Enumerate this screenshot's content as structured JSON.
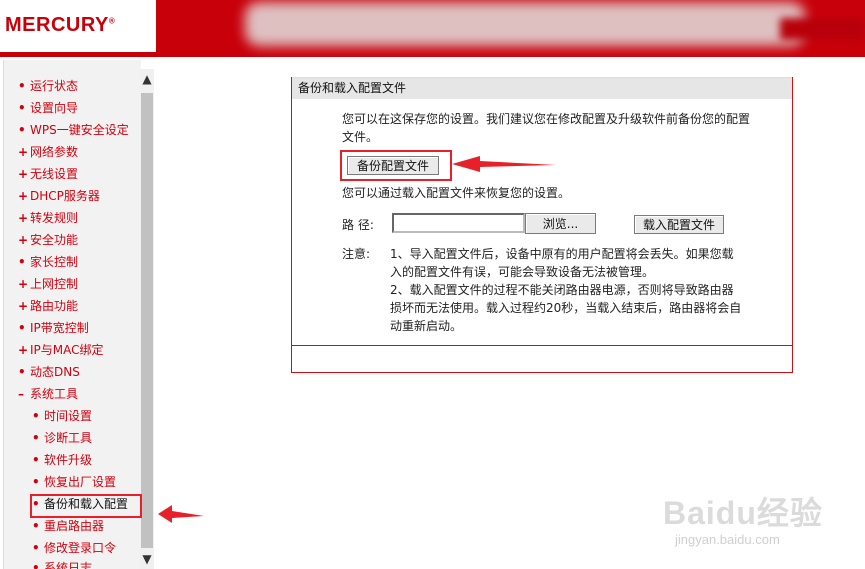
{
  "header": {
    "brand": "MERCURY",
    "brand_mark": "®"
  },
  "sidebar": {
    "items": [
      {
        "label": "运行状态",
        "bullet": "•"
      },
      {
        "label": "设置向导",
        "bullet": "•"
      },
      {
        "label": "WPS一键安全设定",
        "bullet": "•"
      },
      {
        "label": "网络参数",
        "bullet": "+"
      },
      {
        "label": "无线设置",
        "bullet": "+"
      },
      {
        "label": "DHCP服务器",
        "bullet": "+"
      },
      {
        "label": "转发规则",
        "bullet": "+"
      },
      {
        "label": "安全功能",
        "bullet": "+"
      },
      {
        "label": "家长控制",
        "bullet": "•"
      },
      {
        "label": "上网控制",
        "bullet": "+"
      },
      {
        "label": "路由功能",
        "bullet": "+"
      },
      {
        "label": "IP带宽控制",
        "bullet": "•"
      },
      {
        "label": "IP与MAC绑定",
        "bullet": "+"
      },
      {
        "label": "动态DNS",
        "bullet": "•"
      },
      {
        "label": "系统工具",
        "bullet": "–"
      }
    ],
    "sub_items": [
      {
        "label": "时间设置",
        "bullet": "•"
      },
      {
        "label": "诊断工具",
        "bullet": "•"
      },
      {
        "label": "软件升级",
        "bullet": "•"
      },
      {
        "label": "恢复出厂设置",
        "bullet": "•"
      },
      {
        "label": "备份和载入配置",
        "bullet": "•"
      },
      {
        "label": "重启路由器",
        "bullet": "•"
      },
      {
        "label": "修改登录口令",
        "bullet": "•"
      },
      {
        "label": "系统日志",
        "bullet": "•"
      }
    ],
    "scroll_up_icon": "▲",
    "scroll_down_icon": "▼"
  },
  "panel": {
    "title": "备份和载入配置文件",
    "intro": "您可以在这保存您的设置。我们建议您在修改配置及升级软件前备份您的配置文件。",
    "backup_button": "备份配置文件",
    "restore_text": "您可以通过载入配置文件来恢复您的设置。",
    "path_label": "路 径:",
    "path_value": "",
    "browse_button": "浏览...",
    "load_button": "载入配置文件",
    "note_label": "注意:",
    "note_1": "1、导入配置文件后，设备中原有的用户配置将会丢失。如果您载入的配置文件有误，可能会导致设备无法被管理。",
    "note_2": "2、载入配置文件的过程不能关闭路由器电源，否则将导致路由器损坏而无法使用。载入过程约20秒，当载入结束后，路由器将会自动重新启动。"
  },
  "annotations": {
    "highlight_color": "#e8202a"
  },
  "watermark": {
    "main": "Baidu经验",
    "sub": "jingyan.baidu.com"
  },
  "colors": {
    "header_red": "#c8000a",
    "menu_red": "#d2000f",
    "panel_border": "#d20f0f"
  }
}
